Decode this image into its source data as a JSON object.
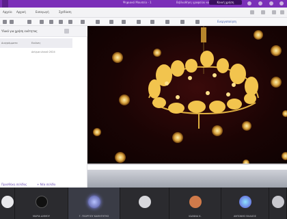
{
  "window": {
    "title": "Ψηφιακό Μουσείο - 1",
    "title2": "Βιβλιοθήκη γραφείου καθηγητή"
  },
  "share_label": "Κοινή χρήση",
  "menu": {
    "items": [
      "Αρχείο",
      "Αρχική",
      "Εισαγωγή",
      "Σχεδίαση"
    ]
  },
  "toolbar": {
    "link_label": "Ενεργοποίηση"
  },
  "left_panel": {
    "title": "Υλικό για χρήση ενότητας",
    "rows": [
      {
        "name": "Διαγράμματα",
        "value": "Εικόνες"
      }
    ],
    "sub_text": "Δείγμα υλικού 2024",
    "footer_left": "Προσθήκη σελίδας",
    "footer_right": "+ Νέα σελίδα"
  },
  "viewer": {
    "subject": "golden-oak-wreath-photo",
    "colors": {
      "gold": "#d9a441",
      "bg": "#1a0404"
    }
  },
  "participants": [
    {
      "name": ""
    },
    {
      "name": "ΜΑΡΙΑ ΔΗΜΟΥ"
    },
    {
      "name": "Γ. ΓΕΩΡΓΙΟΥ ΚΑΘΗΓΗΤΗΣ"
    },
    {
      "name": ""
    },
    {
      "name": "ΙΩΑΝΝΑ Κ."
    },
    {
      "name": "ΑΝΤΩΝΗΣ ΒΛΑΧΟΣ"
    },
    {
      "name": "ΕΛΕΝΗ ΠΑΠΑΔΟΠΟΥΛΟΥ"
    },
    {
      "name": ""
    }
  ]
}
